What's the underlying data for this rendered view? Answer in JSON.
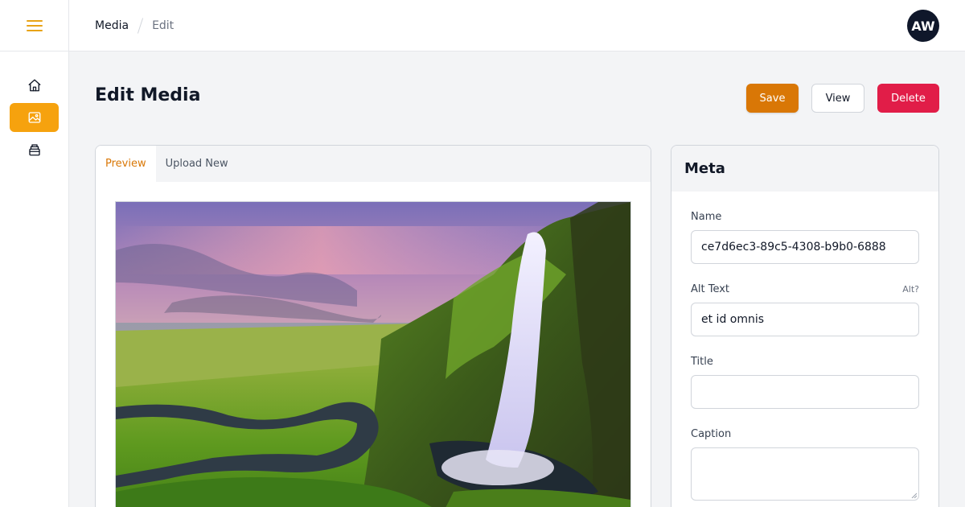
{
  "sidebar": {
    "menu_icon": "hamburger-icon",
    "accent_color": "#f6a20e",
    "items": [
      {
        "icon": "home-icon",
        "active": false
      },
      {
        "icon": "image-icon",
        "active": true
      },
      {
        "icon": "archive-icon",
        "active": false
      }
    ]
  },
  "header": {
    "breadcrumb": [
      "Media",
      "Edit"
    ],
    "avatar_initials": "AW"
  },
  "page": {
    "title": "Edit Media"
  },
  "actions": {
    "save_label": "Save",
    "view_label": "View",
    "delete_label": "Delete",
    "save_color": "#d97706",
    "delete_color": "#e11d48"
  },
  "preview": {
    "tabs": [
      {
        "label": "Preview",
        "active": true
      },
      {
        "label": "Upload New",
        "active": false
      }
    ],
    "image_subject": "waterfall-landscape"
  },
  "meta": {
    "heading": "Meta",
    "fields": {
      "name": {
        "label": "Name",
        "value": "ce7d6ec3-89c5-4308-b9b0-6888"
      },
      "alt_text": {
        "label": "Alt Text",
        "hint": "Alt?",
        "value": "et id omnis"
      },
      "title": {
        "label": "Title",
        "value": ""
      },
      "caption": {
        "label": "Caption",
        "value": ""
      }
    }
  }
}
